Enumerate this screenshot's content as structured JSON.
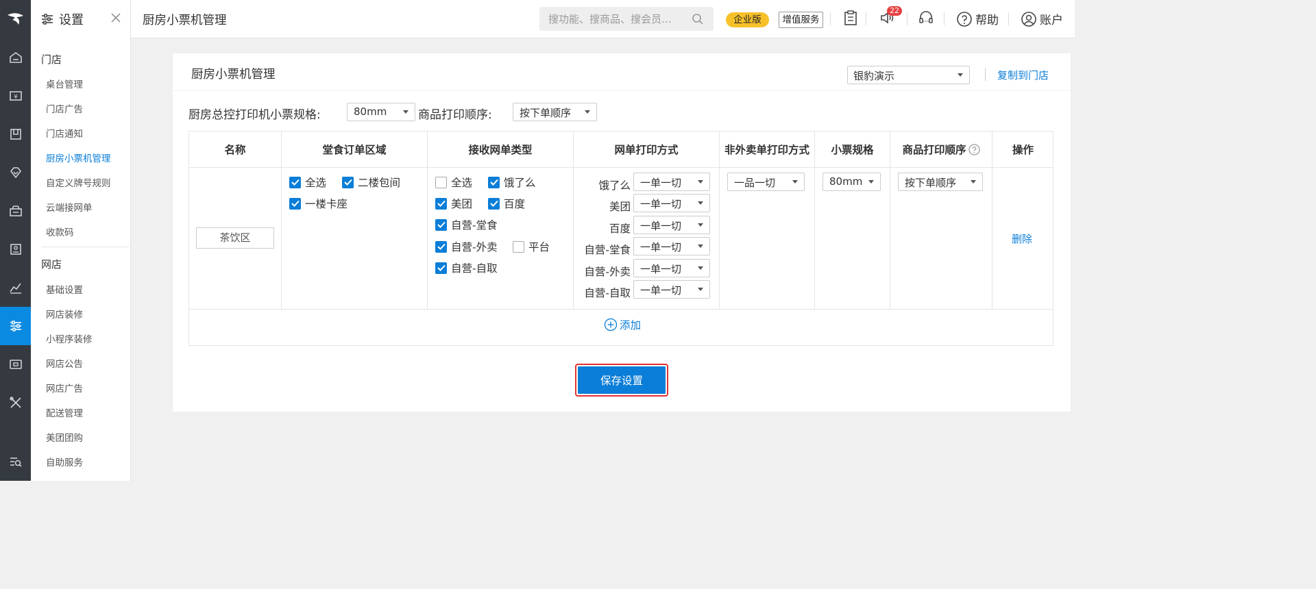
{
  "side": {
    "title": "设置",
    "section_store": "门店",
    "store_items": [
      "桌台管理",
      "门店广告",
      "门店通知",
      "厨房小票机管理",
      "自定义牌号规则",
      "云端接网单",
      "收款码"
    ],
    "section_online": "网店",
    "online_items": [
      "基础设置",
      "网店装修",
      "小程序装修",
      "网店公告",
      "网店广告",
      "配送管理",
      "美团团购",
      "自助服务"
    ]
  },
  "topbar": {
    "title": "厨房小票机管理",
    "search_placeholder": "搜功能、搜商品、搜会员…",
    "enterprise": "企业版",
    "value_added": "增值服务",
    "notif_count": "22",
    "help": "帮助",
    "account": "账户"
  },
  "card": {
    "title": "厨房小票机管理",
    "store_select": "银豹演示",
    "copy_link": "复制到门店",
    "master_spec_label": "厨房总控打印机小票规格:",
    "master_spec_value": "80mm",
    "print_order_label": "商品打印顺序:",
    "print_order_value": "按下单顺序"
  },
  "table": {
    "headers": [
      "名称",
      "堂食订单区域",
      "接收网单类型",
      "网单打印方式",
      "非外卖单打印方式",
      "小票规格",
      "商品打印顺序",
      "操作"
    ],
    "row": {
      "name": "茶饮区",
      "areas": [
        {
          "label": "全选",
          "checked": true
        },
        {
          "label": "二楼包间",
          "checked": true
        },
        {
          "label": "一楼卡座",
          "checked": true
        }
      ],
      "order_types": [
        {
          "label": "全选",
          "checked": false
        },
        {
          "label": "饿了么",
          "checked": true
        },
        {
          "label": "美团",
          "checked": true
        },
        {
          "label": "百度",
          "checked": true
        },
        {
          "label": "自营-堂食",
          "checked": true
        },
        {
          "label": "自营-外卖",
          "checked": true
        },
        {
          "label": "平台",
          "checked": false
        },
        {
          "label": "自营-自取",
          "checked": true
        }
      ],
      "print_modes": [
        {
          "label": "饿了么",
          "value": "一单一切"
        },
        {
          "label": "美团",
          "value": "一单一切"
        },
        {
          "label": "百度",
          "value": "一单一切"
        },
        {
          "label": "自营-堂食",
          "value": "一单一切"
        },
        {
          "label": "自营-外卖",
          "value": "一单一切"
        },
        {
          "label": "自营-自取",
          "value": "一单一切"
        }
      ],
      "non_takeout_mode": "一品一切",
      "ticket_spec": "80mm",
      "print_order": "按下单顺序",
      "delete": "删除"
    },
    "add": "添加"
  },
  "save_label": "保存设置",
  "colors": {
    "accent": "#0a7ed8",
    "rail": "#343a40",
    "enterprise": "#f7c12a",
    "highlight": "#e53030"
  }
}
